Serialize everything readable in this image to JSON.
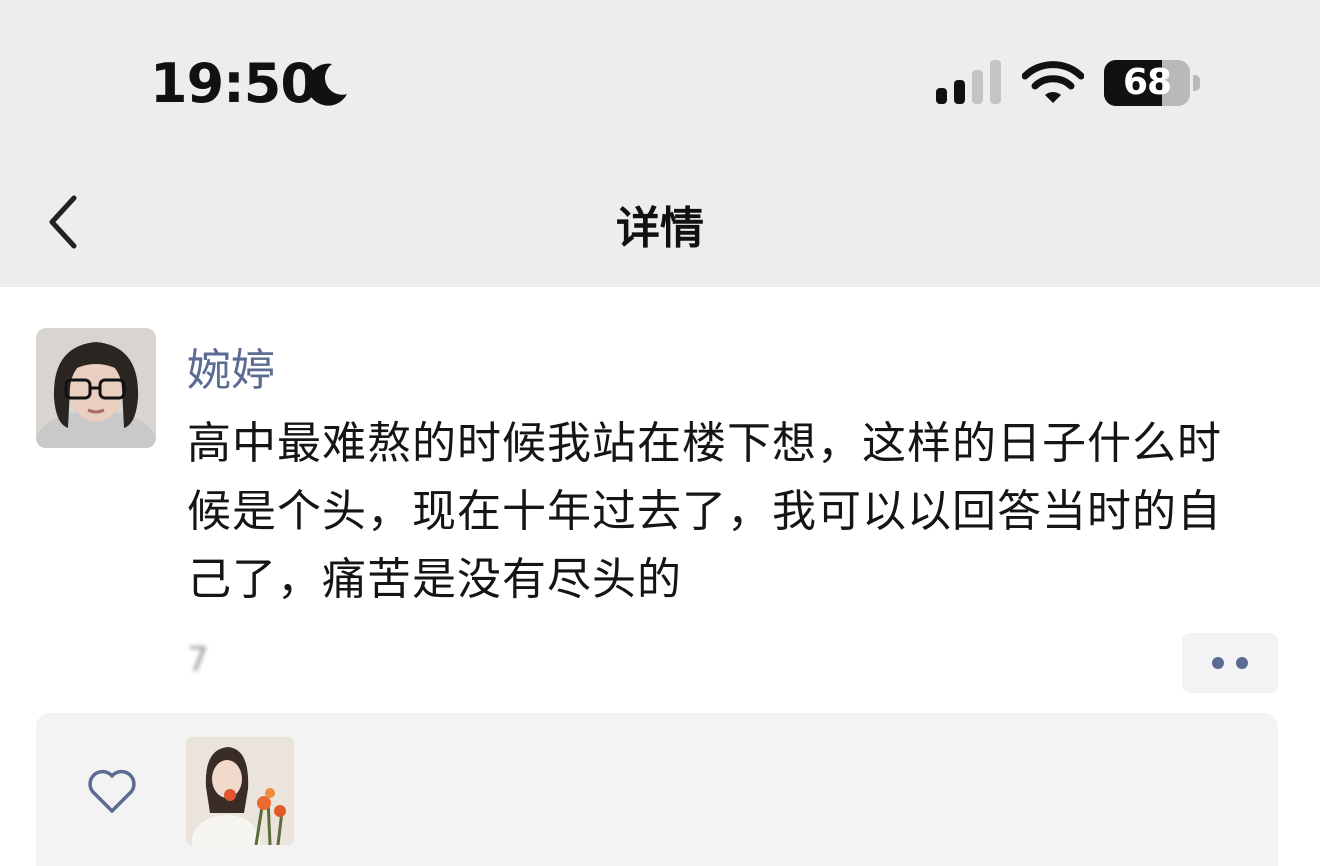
{
  "status_bar": {
    "time": "19:50",
    "battery_level": "68",
    "battery_fraction": 0.68,
    "signal_bars_active": 2,
    "signal_bars_total": 4
  },
  "header": {
    "title": "详情"
  },
  "post": {
    "author": "婉婷",
    "content": "高中最难熬的时候我站在楼下想，这样的日子什么时候是个头，现在十年过去了，我可以以回答当时的自己了，痛苦是没有尽头的",
    "timestamp": "7"
  },
  "colors": {
    "accent": "#5b6b92",
    "header_bg": "#ededed",
    "panel_bg": "#f3f3f3"
  },
  "icons": {
    "back": "chevron-left-icon",
    "more": "more-dots-icon",
    "like": "heart-outline-icon",
    "moon": "moon-icon",
    "wifi": "wifi-icon"
  }
}
